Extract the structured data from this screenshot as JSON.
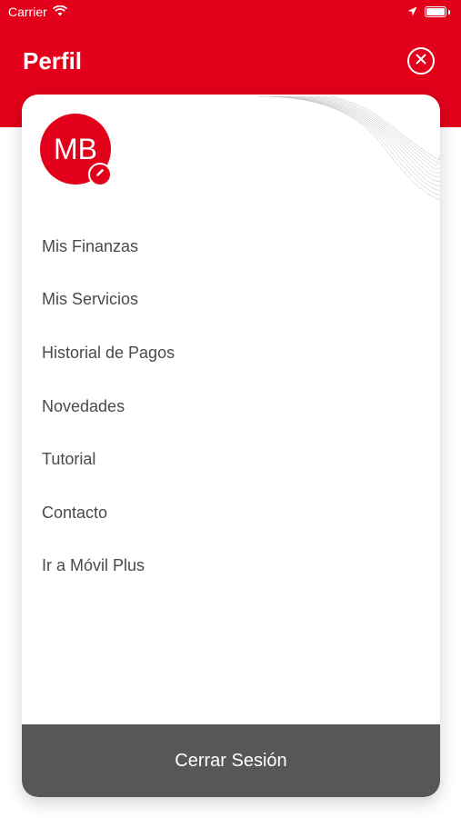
{
  "status_bar": {
    "carrier": "Carrier",
    "icons": [
      "wifi-icon",
      "location-arrow-icon",
      "battery-icon"
    ]
  },
  "header": {
    "title": "Perfil",
    "close_icon": "close-circle-icon"
  },
  "profile": {
    "initials": "MB",
    "edit_icon": "pencil-icon"
  },
  "menu": {
    "items": [
      {
        "label": "Mis Finanzas"
      },
      {
        "label": "Mis Servicios"
      },
      {
        "label": "Historial de Pagos"
      },
      {
        "label": "Novedades"
      },
      {
        "label": "Tutorial"
      },
      {
        "label": "Contacto"
      },
      {
        "label": "Ir a Móvil Plus"
      }
    ]
  },
  "footer": {
    "logout_label": "Cerrar Sesión"
  },
  "colors": {
    "brand_red": "#e2001a",
    "logout_bg": "#575757",
    "menu_text": "#4a4a4a"
  }
}
